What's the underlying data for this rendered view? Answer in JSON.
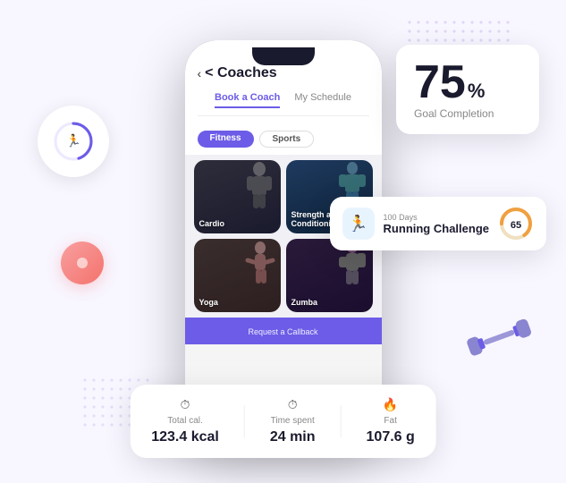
{
  "background": {
    "color": "#f8f6ff"
  },
  "phone": {
    "header": {
      "back_label": "< Coaches"
    },
    "tabs": [
      {
        "label": "Book a Coach",
        "active": true
      },
      {
        "label": "My Schedule",
        "active": false
      }
    ],
    "filters": [
      {
        "label": "Fitness",
        "active": true
      },
      {
        "label": "Sports",
        "active": false
      }
    ],
    "coaches": [
      {
        "label": "Cardio",
        "style": "card-cardio"
      },
      {
        "label": "Strength and Conditioning",
        "style": "card-strength"
      },
      {
        "label": "Yoga",
        "style": "card-yoga"
      },
      {
        "label": "Zumba",
        "style": "card-zumba"
      }
    ],
    "bottom_cta": "Request a Callback"
  },
  "goal_card": {
    "value": "75",
    "percent": "%",
    "label": "Goal Completion"
  },
  "challenge_card": {
    "days": "100 Days",
    "name": "Running Challenge",
    "progress": 65,
    "progress_color": "#f0a040"
  },
  "stats_card": {
    "items": [
      {
        "icon": "⏱",
        "label": "Total cal.",
        "value": "123.4 kcal"
      },
      {
        "icon": "⏱",
        "label": "Time spent",
        "value": "24 min"
      },
      {
        "icon": "🔥",
        "label": "Fat",
        "value": "107.6 g"
      }
    ]
  },
  "running_circle": {
    "progress": 70,
    "color": "#6c5ce7"
  }
}
